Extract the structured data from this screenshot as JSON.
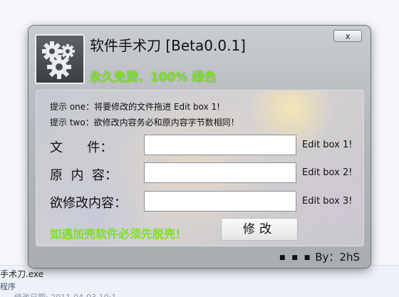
{
  "window": {
    "title": "软件手术刀 [Beta0.0.1]",
    "subtitle": "永久免费、100% 绿色",
    "close_label": "x",
    "icon": "gears-icon"
  },
  "hints": [
    "提示 one：将要修改的文件拖进 Edit box 1!",
    "提示 two：欲修改内容务必和原内容字节数相同！"
  ],
  "fields": [
    {
      "label": "文      件：",
      "value": "",
      "tag": "Edit box 1!"
    },
    {
      "label": "原  内  容：",
      "value": "",
      "tag": "Edit box 2!"
    },
    {
      "label": "欲修改内容：",
      "value": "",
      "tag": "Edit box 3!"
    }
  ],
  "warning": "如遇加壳软件必须先脱壳！",
  "modify_label": "修改",
  "footer": {
    "dots": "■ ■ ■",
    "author": "By：2hS"
  },
  "desktop": {
    "filename": "手术刀.exe",
    "type": "程序",
    "meta": "修改日期: 2011-04-03 10:1"
  },
  "colors": {
    "accent_green": "#7ce21e"
  }
}
